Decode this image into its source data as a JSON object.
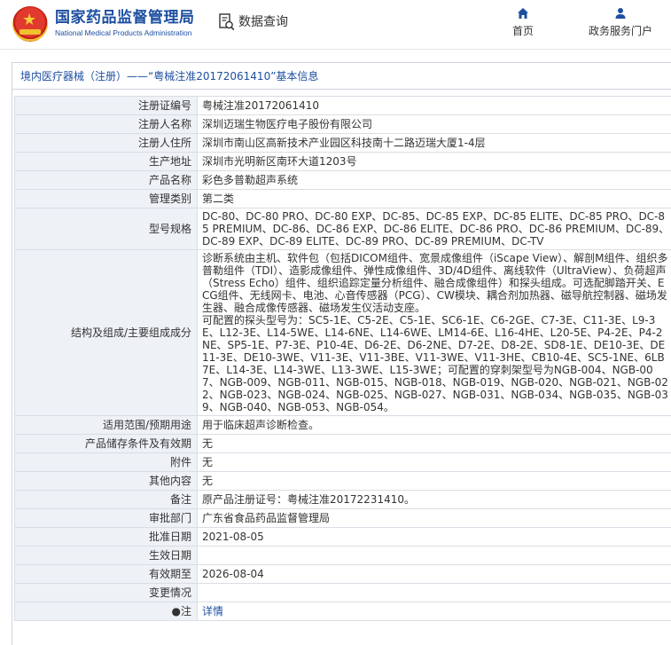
{
  "header": {
    "site_name_cn": "国家药品监督管理局",
    "site_name_en": "National Medical Products Administration",
    "query_label": "数据查询",
    "nav": [
      {
        "icon": "home-icon",
        "label": "首页"
      },
      {
        "icon": "user-icon",
        "label": "政务服务门户"
      }
    ]
  },
  "breadcrumb": {
    "title": "境内医疗器械（注册）——“粤械注准20172061410”基本信息"
  },
  "record": {
    "rows": [
      {
        "label": "注册证编号",
        "value": "粤械注准20172061410"
      },
      {
        "label": "注册人名称",
        "value": "深圳迈瑞生物医疗电子股份有限公司"
      },
      {
        "label": "注册人住所",
        "value": "深圳市南山区高新技术产业园区科技南十二路迈瑞大厦1-4层"
      },
      {
        "label": "生产地址",
        "value": "深圳市光明新区南环大道1203号"
      },
      {
        "label": "产品名称",
        "value": "彩色多普勒超声系统"
      },
      {
        "label": "管理类别",
        "value": "第二类"
      },
      {
        "label": "型号规格",
        "value": "DC-80、DC-80 PRO、DC-80 EXP、DC-85、DC-85 EXP、DC-85 ELITE、DC-85 PRO、DC-85 PREMIUM、DC-86、DC-86 EXP、DC-86 ELITE、DC-86 PRO、DC-86 PREMIUM、DC-89、DC-89 EXP、DC-89 ELITE、DC-89 PRO、DC-89 PREMIUM、DC-TV"
      },
      {
        "label": "结构及组成/主要组成成分",
        "value": "诊断系统由主机、软件包（包括DICOM组件、宽景成像组件（iScape View）、解剖M组件、组织多普勒组件（TDI）、造影成像组件、弹性成像组件、3D/4D组件、离线软件（UltraView）、负荷超声（Stress Echo）组件、组织追踪定量分析组件、融合成像组件）和探头组成。可选配脚踏开关、ECG组件、无线网卡、电池、心音传感器（PCG）、CW模块、耦合剂加热器、磁导航控制器、磁场发生器、融合成像传感器、磁场发生仪活动支座。\n可配置的探头型号为：SC5-1E、C5-2E、C5-1E、SC6-1E、C6-2GE、C7-3E、C11-3E、L9-3E、L12-3E、L14-5WE、L14-6NE、L14-6WE、LM14-6E、L16-4HE、L20-5E、P4-2E、P4-2NE、SP5-1E、P7-3E、P10-4E、D6-2E、D6-2NE、D7-2E、D8-2E、SD8-1E、DE10-3E、DE11-3E、DE10-3WE、V11-3E、V11-3BE、V11-3WE、V11-3HE、CB10-4E、SC5-1NE、6LB7E、L14-3E、L14-3WE、L13-3WE、L15-3WE；可配置的穿刺架型号为NGB-004、NGB-007、NGB-009、NGB-011、NGB-015、NGB-018、NGB-019、NGB-020、NGB-021、NGB-022、NGB-023、NGB-024、NGB-025、NGB-027、NGB-031、NGB-034、NGB-035、NGB-039、NGB-040、NGB-053、NGB-054。"
      },
      {
        "label": "适用范围/预期用途",
        "value": "用于临床超声诊断检查。"
      },
      {
        "label": "产品储存条件及有效期",
        "value": "无"
      },
      {
        "label": "附件",
        "value": "无"
      },
      {
        "label": "其他内容",
        "value": "无"
      },
      {
        "label": "备注",
        "value": "原产品注册证号：粤械注准20172231410。"
      },
      {
        "label": "审批部门",
        "value": "广东省食品药品监督管理局"
      },
      {
        "label": "批准日期",
        "value": "2021-08-05"
      },
      {
        "label": "生效日期",
        "value": ""
      },
      {
        "label": "有效期至",
        "value": "2026-08-04"
      },
      {
        "label": "变更情况",
        "value": ""
      }
    ],
    "note_label": "●注",
    "note_link": "详情"
  },
  "colors": {
    "brand": "#1d4fa1",
    "label_bg": "#eef1f6",
    "border": "#d9dee5"
  }
}
